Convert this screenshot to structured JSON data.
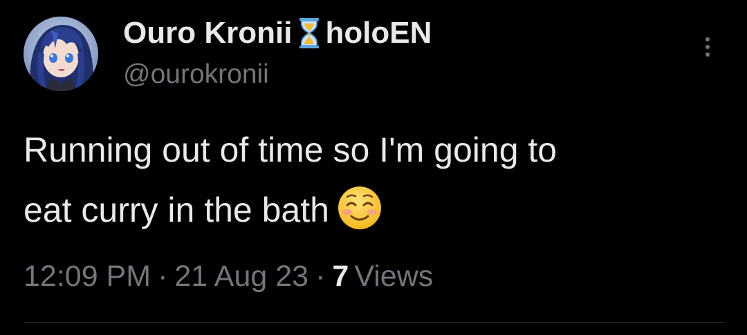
{
  "author": {
    "display_name_part1": "Ouro Kronii",
    "display_name_icon": "hourglass-icon",
    "display_name_part2": "holoEN",
    "handle": "@ourokronii",
    "avatar_icon": "avatar-anime-girl-blue-hair"
  },
  "tweet": {
    "text_line1": "Running out of time so I'm going to",
    "text_line2": "eat curry in the bath",
    "emoji_icon": "smiling-face-icon"
  },
  "meta": {
    "time": "12:09 PM",
    "separator": "·",
    "date": "21 Aug 23",
    "views_count": "7",
    "views_label": "Views"
  },
  "menu": {
    "more_icon": "more-vertical-icon"
  },
  "colors": {
    "background": "#000000",
    "primary_text": "#e7e9ea",
    "secondary_text": "#71767b",
    "divider": "#2f3336"
  }
}
